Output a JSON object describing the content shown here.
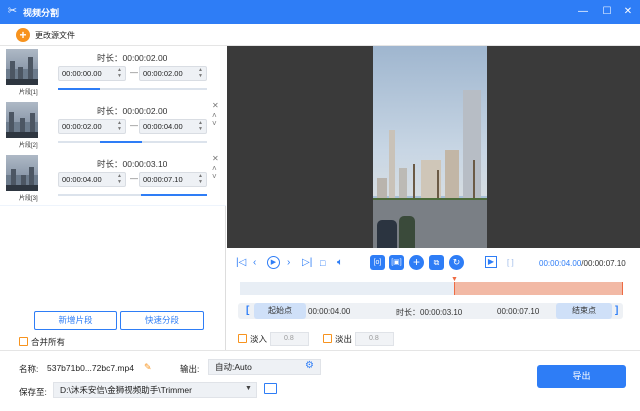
{
  "window": {
    "title": "视频分割",
    "app_icon": "scissors-icon",
    "minimize": "—",
    "maximize": "☐",
    "close": "✕"
  },
  "toolbar": {
    "change_source": "更改源文件"
  },
  "segments": [
    {
      "label": "片段[1]",
      "duration_label": "时长：00:00:02.00",
      "start": "00:00:00.00",
      "end": "00:00:02.00",
      "progress_start": 0.0,
      "progress_end": 0.28
    },
    {
      "label": "片段[2]",
      "duration_label": "时长：00:00:02.00",
      "start": "00:00:02.00",
      "end": "00:00:04.00",
      "progress_start": 0.28,
      "progress_end": 0.56
    },
    {
      "label": "片段[3]",
      "duration_label": "时长：00:00:03.10",
      "start": "00:00:04.00",
      "end": "00:00:07.10",
      "progress_start": 0.56,
      "progress_end": 1.0
    }
  ],
  "buttons": {
    "add_segment": "新增片段",
    "quick_split": "快速分段",
    "merge_all": "合并所有",
    "export": "导出"
  },
  "player": {
    "current_time": "00:00:04.00",
    "total_time": "/00:00:07.10"
  },
  "range": {
    "start_btn": "起始点",
    "start_time": "00:00:04.00",
    "duration": "时长：00:00:03.10",
    "end_time": "00:00:07.10",
    "end_btn": "结束点",
    "selection_start": 0.56,
    "selection_end": 1.0
  },
  "fade": {
    "fade_in_label": "淡入",
    "fade_in_value": "0.8",
    "fade_out_label": "淡出",
    "fade_out_value": "0.8"
  },
  "output": {
    "name_label": "名称:",
    "name_value": "537b71b0...72bc7.mp4",
    "output_label": "输出:",
    "output_value": "自动:Auto",
    "save_label": "保存至:",
    "save_path": "D:\\沐禾安信\\金狮视频助手\\Trimmer"
  },
  "colors": {
    "accent": "#2e7df6",
    "orange": "#f7931e",
    "selection": "#f2b9a5"
  }
}
